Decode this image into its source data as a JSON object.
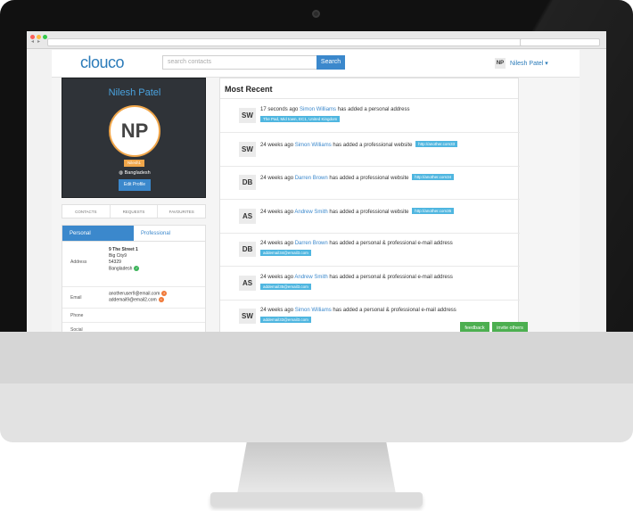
{
  "header": {
    "logo": "clouco",
    "search_placeholder": "search contacts",
    "search_button": "Search",
    "user_initials": "NP",
    "user_name": "Nilesh Patel ▾"
  },
  "profile": {
    "name": "Nilesh Patel",
    "initials": "NP",
    "tag": "Nilesh1",
    "location": "Bangladesh",
    "edit_button": "Edit Profile"
  },
  "section_tabs": [
    "CONTACTS",
    "REQUESTS",
    "FAVOURITES"
  ],
  "profile_tabs": {
    "personal": "Personal",
    "professional": "Professional"
  },
  "details": {
    "address_label": "Address",
    "address_lines": [
      "9 The Street 1",
      "Big City9",
      "54329",
      "Bangladesh"
    ],
    "email_label": "Email",
    "emails": [
      "anotheruser9@email.com",
      "addemail9@email2.com"
    ],
    "phone_label": "Phone",
    "social_label": "Social"
  },
  "feed": {
    "title": "Most Recent",
    "items": [
      {
        "initials": "SW",
        "time": "17 seconds ago",
        "person": "Simon Williams",
        "action": "has added a personal address",
        "detail": "The Pad, Mid town, EC1, United Kingdom",
        "detail_below": true
      },
      {
        "initials": "SW",
        "time": "24 weeks ago",
        "person": "Simon Williams",
        "action": "has added a professional website",
        "detail": "http://another.com33",
        "detail_below": false
      },
      {
        "initials": "DB",
        "time": "24 weeks ago",
        "person": "Darren Brown",
        "action": "has added a professional website",
        "detail": "http://another.com34",
        "detail_below": false
      },
      {
        "initials": "AS",
        "time": "24 weeks ago",
        "person": "Andrew Smith",
        "action": "has added a professional website",
        "detail": "http://another.com35",
        "detail_below": false
      },
      {
        "initials": "DB",
        "time": "24 weeks ago",
        "person": "Darren Brown",
        "action": "has added a personal & professional e-mail address",
        "detail": "addemail34@email3.com",
        "detail_below": true
      },
      {
        "initials": "AS",
        "time": "24 weeks ago",
        "person": "Andrew Smith",
        "action": "has added a personal & professional e-mail address",
        "detail": "addemail35@email3.com",
        "detail_below": true
      },
      {
        "initials": "SW",
        "time": "24 weeks ago",
        "person": "Simon Williams",
        "action": "has added a personal & professional e-mail address",
        "detail": "addemail33@email3.com",
        "detail_below": true
      }
    ]
  },
  "buttons": {
    "feedback": "feedback",
    "invite": "invite others"
  }
}
